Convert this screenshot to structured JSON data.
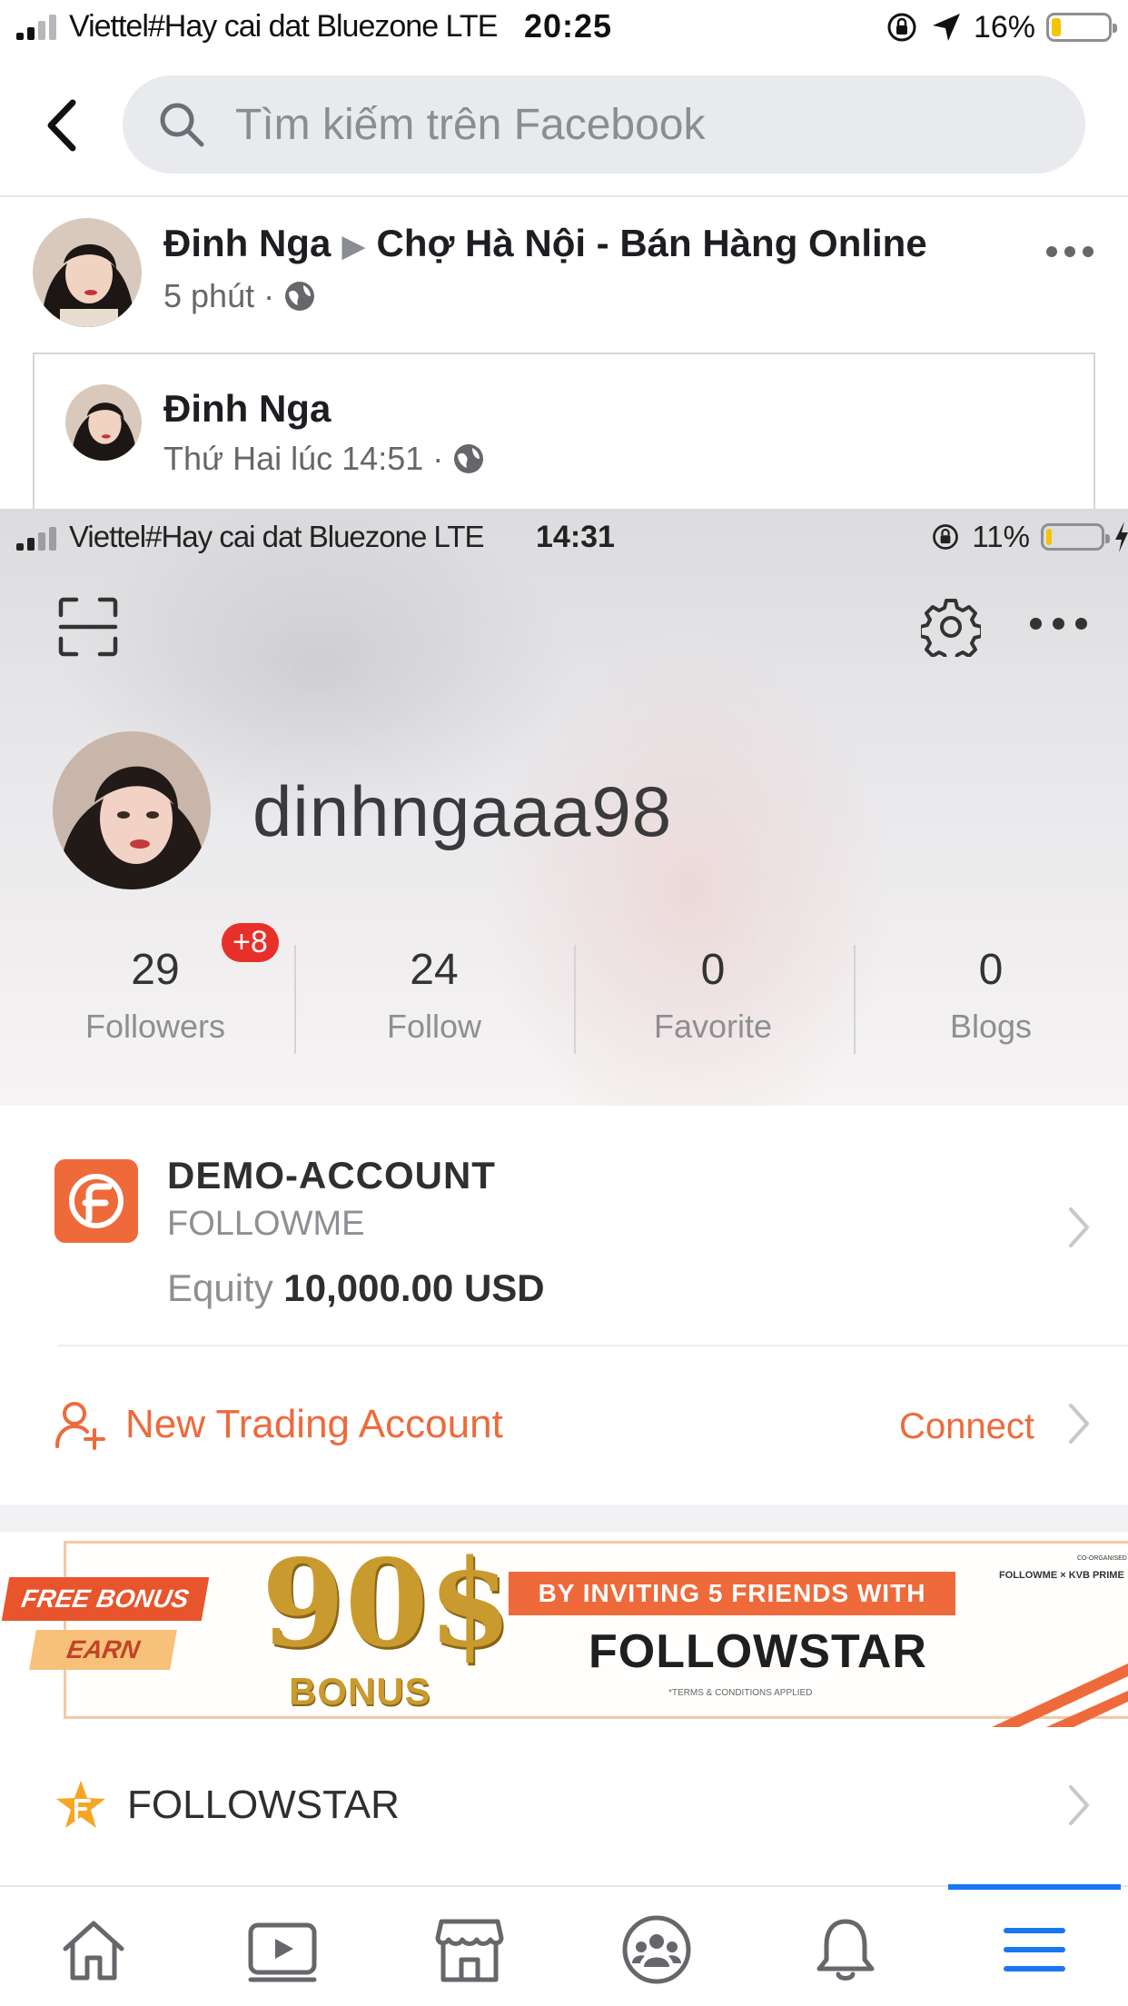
{
  "fb_status": {
    "carrier": "Viettel#Hay cai dat Bluezone  LTE",
    "time": "20:25",
    "battery_pct": "16%",
    "battery_level": 0.16
  },
  "search": {
    "placeholder": "Tìm kiếm trên Facebook"
  },
  "post": {
    "author": "Đinh Nga",
    "group": "Chợ Hà Nội - Bán Hàng Online",
    "time": "5 phút",
    "separator": "·"
  },
  "shared": {
    "author": "Đinh Nga",
    "time": "Thứ Hai lúc 14:51",
    "separator": "·"
  },
  "screenshot": {
    "status": {
      "carrier": "Viettel#Hay cai dat Bluezone  LTE",
      "time": "14:31",
      "battery_pct": "11%",
      "battery_level": 0.11
    },
    "username": "dinhngaaa98",
    "stats": [
      {
        "value": "29",
        "label": "Followers",
        "badge": "+8"
      },
      {
        "value": "24",
        "label": "Follow"
      },
      {
        "value": "0",
        "label": "Favorite"
      },
      {
        "value": "0",
        "label": "Blogs"
      }
    ],
    "account": {
      "name": "DEMO-ACCOUNT",
      "broker": "FOLLOWME",
      "equity_label": "Equity",
      "equity_value": "10,000.00",
      "equity_currency": "USD"
    },
    "new_account": {
      "label": "New Trading Account",
      "action": "Connect"
    },
    "banner": {
      "free_bonus": "FREE BONUS",
      "earn": "EARN",
      "amount": "90$",
      "bonus": "BONUS",
      "invite": "BY INVITING 5 FRIENDS WITH",
      "brand": "FOLLOWSTAR",
      "terms": "*TERMS & CONDITIONS APPLIED",
      "cobrand": "FOLLOWME × KVB PRIME",
      "co_organised": "CO-ORGANISED"
    },
    "followstar_row": "FOLLOWSTAR"
  },
  "colors": {
    "facebook_blue": "#1877f2",
    "followme_orange": "#ee6a3b",
    "badge_red": "#e8302a"
  },
  "bottom_nav": {
    "items": [
      "home-icon",
      "video-icon",
      "marketplace-icon",
      "groups-icon",
      "notifications-icon",
      "menu-icon"
    ],
    "active": "menu-icon"
  }
}
